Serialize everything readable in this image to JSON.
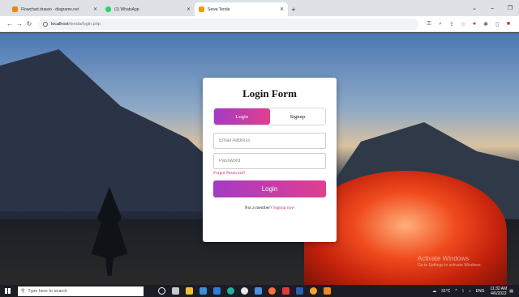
{
  "browser": {
    "tabs": [
      {
        "title": "Flowchart.drawio - diagrams.net",
        "favicon_color": "#f08705",
        "active": false
      },
      {
        "title": "(1) WhatsApp",
        "favicon_color": "#25d366",
        "active": false
      },
      {
        "title": "Sewa Tenda",
        "favicon_color": "#f39c12",
        "active": true
      }
    ],
    "new_tab_label": "+",
    "url_host": "localhost",
    "url_path": "/tenda/login.php"
  },
  "login": {
    "title": "Login Form",
    "tab_login": "Login",
    "tab_signup": "Signup",
    "email_placeholder": "Email Address",
    "password_placeholder": "Password",
    "forgot_link": "Forgot Password?",
    "login_button": "Login",
    "member_text": "Not a member?",
    "signup_link": "Signup now"
  },
  "watermark": {
    "line1": "Activate Windows",
    "line2": "Go to Settings to activate Windows."
  },
  "taskbar": {
    "search_placeholder": "Type here to search",
    "weather": "31°C",
    "language": "ENG",
    "time": "11:32 AM",
    "date": "4/6/2022"
  },
  "colors": {
    "accent_gradient_start": "#a43bc4",
    "accent_gradient_end": "#e13f8f",
    "link": "#d1257a"
  }
}
